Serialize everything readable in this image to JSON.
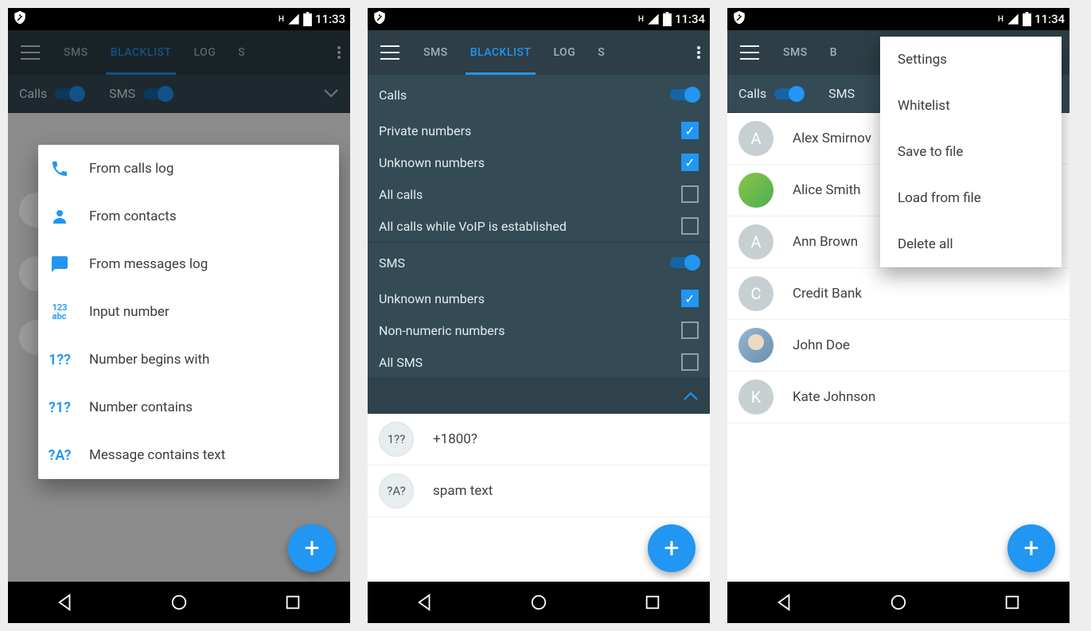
{
  "phones": {
    "a": {
      "time": "11:33",
      "tabs": [
        "SMS",
        "BLACKLIST",
        "LOG",
        "S"
      ],
      "active_tab": 1,
      "toggles": {
        "calls": "Calls",
        "sms": "SMS"
      },
      "popup": [
        {
          "icon": "phone",
          "label": "From calls log"
        },
        {
          "icon": "person",
          "label": "From contacts"
        },
        {
          "icon": "chat",
          "label": "From messages log"
        },
        {
          "icon": "123abc",
          "label": "Input number"
        },
        {
          "icon": "1??",
          "label": "Number begins with"
        },
        {
          "icon": "?1?",
          "label": "Number contains"
        },
        {
          "icon": "?A?",
          "label": "Message contains text"
        }
      ]
    },
    "b": {
      "time": "11:34",
      "tabs": [
        "SMS",
        "BLACKLIST",
        "LOG",
        "S"
      ],
      "active_tab": 1,
      "calls_section": {
        "title": "Calls",
        "items": [
          {
            "label": "Private numbers",
            "checked": true
          },
          {
            "label": "Unknown numbers",
            "checked": true
          },
          {
            "label": "All calls",
            "checked": false
          },
          {
            "label": "All calls while VoIP is established",
            "checked": false
          }
        ]
      },
      "sms_section": {
        "title": "SMS",
        "items": [
          {
            "label": "Unknown numbers",
            "checked": true
          },
          {
            "label": "Non-numeric numbers",
            "checked": false
          },
          {
            "label": "All SMS",
            "checked": false
          }
        ]
      },
      "rules": [
        {
          "badge": "1??",
          "label": "+1800?"
        },
        {
          "badge": "?A?",
          "label": "spam text"
        }
      ]
    },
    "c": {
      "time": "11:34",
      "tabs": [
        "SMS",
        "B"
      ],
      "toggles": {
        "calls": "Calls",
        "sms": "SMS"
      },
      "contacts": [
        {
          "initial": "A",
          "name": "Alex Smirnov",
          "type": "letter"
        },
        {
          "initial": "",
          "name": "Alice Smith",
          "type": "green"
        },
        {
          "initial": "A",
          "name": "Ann Brown",
          "type": "letter"
        },
        {
          "initial": "C",
          "name": "Credit Bank",
          "type": "letter"
        },
        {
          "initial": "",
          "name": "John Doe",
          "type": "photo"
        },
        {
          "initial": "K",
          "name": "Kate Johnson",
          "type": "letter"
        }
      ],
      "overflow": [
        "Settings",
        "Whitelist",
        "Save to file",
        "Load from file",
        "Delete all"
      ]
    }
  }
}
